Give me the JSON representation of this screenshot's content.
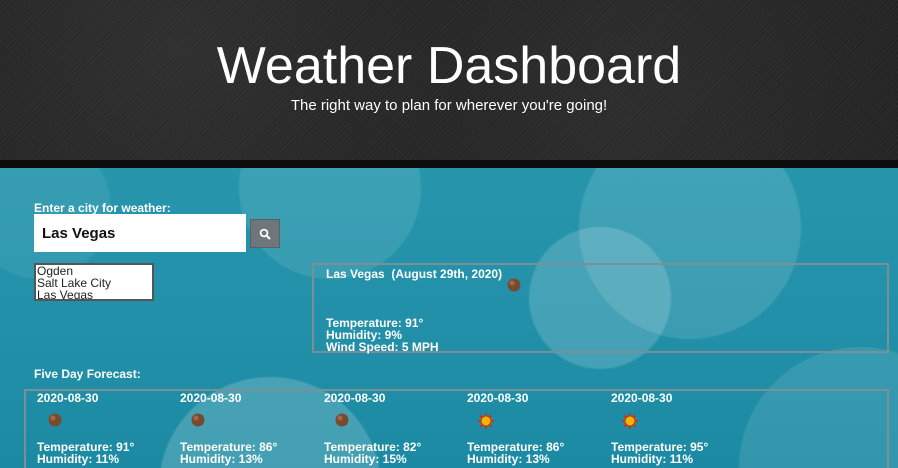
{
  "header": {
    "title": "Weather Dashboard",
    "tagline": "The right way to plan for wherever you're going!"
  },
  "search": {
    "label": "Enter a city for weather:",
    "value": "Las Vegas",
    "button_icon": "search-icon"
  },
  "history": [
    "Ogden",
    "Salt Lake City",
    "Las Vegas"
  ],
  "current": {
    "city": "Las Vegas",
    "date": "(August 29th, 2020)",
    "icon": "clouds-icon",
    "temperature": "Temperature: 91°",
    "humidity": "Humidity: 9%",
    "wind": "Wind Speed: 5 MPH"
  },
  "forecast": {
    "label": "Five Day Forecast:",
    "days": [
      {
        "date": "2020-08-30",
        "icon": "clouds-icon",
        "temperature": "Temperature: 91°",
        "humidity": "Humidity: 11%"
      },
      {
        "date": "2020-08-30",
        "icon": "clouds-icon",
        "temperature": "Temperature: 86°",
        "humidity": "Humidity: 13%"
      },
      {
        "date": "2020-08-30",
        "icon": "clouds-icon",
        "temperature": "Temperature: 82°",
        "humidity": "Humidity: 15%"
      },
      {
        "date": "2020-08-30",
        "icon": "sun-icon",
        "temperature": "Temperature: 86°",
        "humidity": "Humidity: 13%"
      },
      {
        "date": "2020-08-30",
        "icon": "sun-icon",
        "temperature": "Temperature: 95°",
        "humidity": "Humidity: 11%"
      }
    ]
  }
}
